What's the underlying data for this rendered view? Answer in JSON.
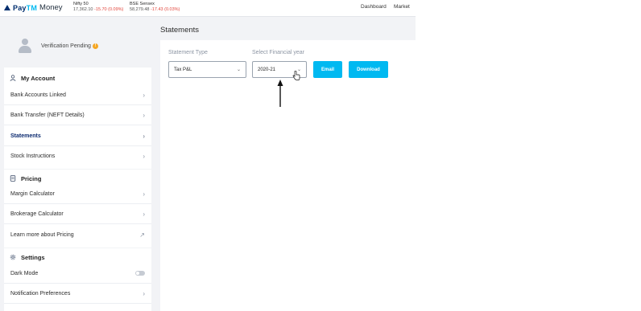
{
  "brand": {
    "name_pre": "Pay",
    "name_tm": "TM",
    "name_post": "Money"
  },
  "tickers": [
    {
      "name": "Nifty 50",
      "value": "17,362.10",
      "change": "-15.70 (0.09%)"
    },
    {
      "name": "BSE Sensex",
      "value": "58,279.48",
      "change": "-17.43 (0.03%)"
    }
  ],
  "topnav": {
    "dashboard": "Dashboard",
    "market": "Market"
  },
  "profile": {
    "status": "Verification Pending",
    "status_badge": "!"
  },
  "sidebar": {
    "my_account": {
      "title": "My Account",
      "items": [
        {
          "label": "Bank Accounts Linked"
        },
        {
          "label": "Bank Transfer (NEFT Details)"
        },
        {
          "label": "Statements"
        },
        {
          "label": "Stock Instructions"
        }
      ]
    },
    "pricing": {
      "title": "Pricing",
      "items": [
        {
          "label": "Margin Calculator"
        },
        {
          "label": "Brokerage Calculator"
        },
        {
          "label": "Learn more about Pricing"
        }
      ]
    },
    "settings": {
      "title": "Settings",
      "items": [
        {
          "label": "Dark Mode"
        },
        {
          "label": "Notification Preferences"
        }
      ]
    }
  },
  "main": {
    "title": "Statements",
    "statement_type": {
      "label": "Statement Type",
      "value": "Tax P&L"
    },
    "financial_year": {
      "label": "Select Financial year",
      "value": "2020-21"
    },
    "email_label": "Email",
    "download_label": "Download"
  },
  "colors": {
    "accent": "#00b9f1",
    "brand_navy": "#002e6e",
    "negative": "#e2463c",
    "active_nav": "#0b2a6f"
  },
  "icons": {
    "chevron": "›",
    "external": "↗",
    "caret": "⌄"
  }
}
